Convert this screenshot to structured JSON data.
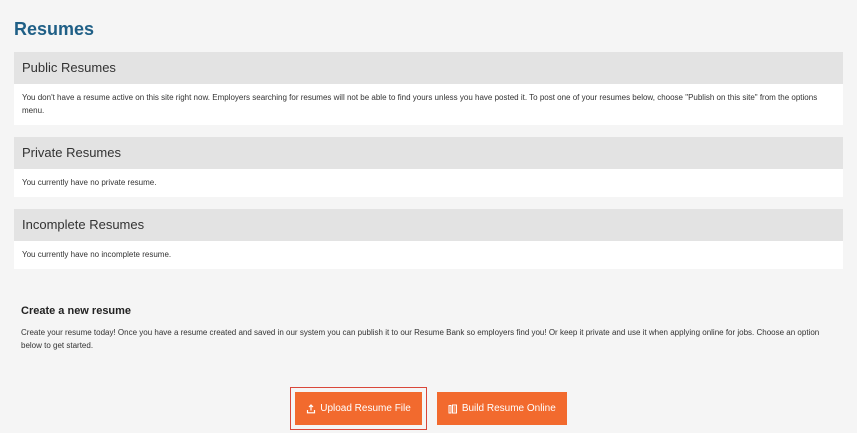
{
  "page": {
    "title": "Resumes"
  },
  "sections": [
    {
      "heading": "Public Resumes",
      "body": "You don't have a resume active on this site right now. Employers searching for resumes will not be able to find yours unless you have posted it. To post one of your resumes below, choose \"Publish on this site\" from the options menu."
    },
    {
      "heading": "Private Resumes",
      "body": "You currently have no private resume."
    },
    {
      "heading": "Incomplete Resumes",
      "body": "You currently have no incomplete resume."
    }
  ],
  "create": {
    "title": "Create a new resume",
    "description": "Create your resume today! Once you have a resume created and saved in our system you can publish it to our Resume Bank so employers find you! Or keep it private and use it when applying online for jobs. Choose an option below to get started."
  },
  "buttons": {
    "upload_label": "Upload Resume File",
    "upload_icon": "upload-icon",
    "build_label": "Build Resume Online",
    "build_icon": "document-icon",
    "accent_color": "#f26a2e",
    "focus_color": "#d9473a"
  }
}
